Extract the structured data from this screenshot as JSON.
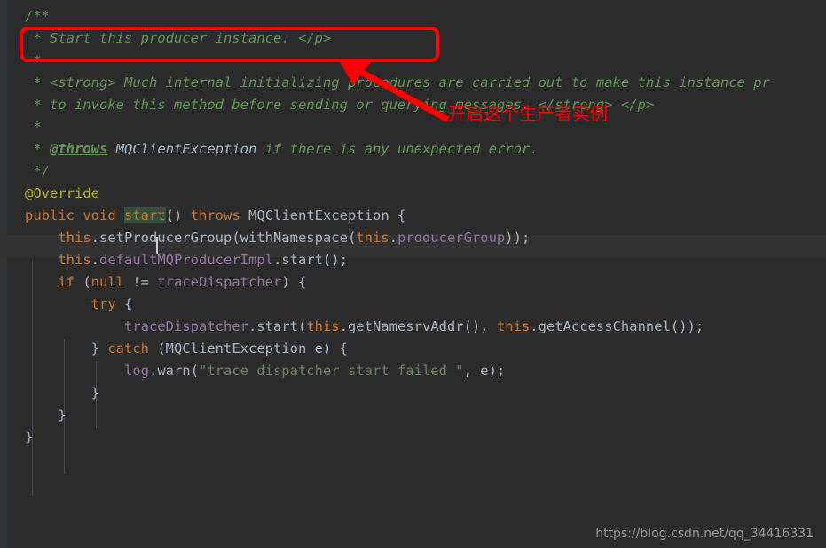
{
  "editor": {
    "background_color": "#2b2b2b",
    "current_line_color": "#323232",
    "gutter_color": "#313335",
    "language": "java",
    "caret_line": 11,
    "caret_column": 4,
    "identifier_under_caret": "start"
  },
  "colors": {
    "comment": "#629755",
    "keyword": "#cc7832",
    "annotation": "#bbb529",
    "field": "#9876aa",
    "string": "#6a8759",
    "plain": "#a9b7c6",
    "annotation_red": "#fe0000",
    "occurrence_highlight": "#32503c"
  },
  "code": {
    "lines": [
      {
        "indent": 0,
        "tokens": [
          {
            "t": "/**",
            "c": "comment"
          }
        ]
      },
      {
        "indent": 0,
        "tokens": [
          {
            "t": " * Start this producer instance. </p>",
            "c": "comment"
          }
        ]
      },
      {
        "indent": 0,
        "tokens": [
          {
            "t": " *",
            "c": "comment"
          }
        ]
      },
      {
        "indent": 0,
        "tokens": [
          {
            "t": " * <strong> Much internal initializing procedures are carried out to make this instance pr",
            "c": "comment"
          }
        ]
      },
      {
        "indent": 0,
        "tokens": [
          {
            "t": " * to invoke this method before sending or querying messages. </strong> </p>",
            "c": "comment"
          }
        ]
      },
      {
        "indent": 0,
        "tokens": [
          {
            "t": " *",
            "c": "comment"
          }
        ]
      },
      {
        "indent": 0,
        "tokens": [
          {
            "t": " * ",
            "c": "comment"
          },
          {
            "t": "@throws",
            "c": "doctag"
          },
          {
            "t": " ",
            "c": "comment"
          },
          {
            "t": "MQClientException",
            "c": "docclass"
          },
          {
            "t": " if there is any unexpected error.",
            "c": "comment"
          }
        ]
      },
      {
        "indent": 0,
        "tokens": [
          {
            "t": " */",
            "c": "comment"
          }
        ]
      },
      {
        "indent": 0,
        "tokens": [
          {
            "t": "@Override",
            "c": "anno"
          }
        ]
      },
      {
        "indent": 0,
        "tokens": [
          {
            "t": "public",
            "c": "keyword"
          },
          {
            "t": " ",
            "c": "plain"
          },
          {
            "t": "void",
            "c": "keyword"
          },
          {
            "t": " ",
            "c": "plain"
          },
          {
            "t": "start",
            "c": "keyword",
            "hl": true
          },
          {
            "t": "() ",
            "c": "plain"
          },
          {
            "t": "throws",
            "c": "keyword"
          },
          {
            "t": " ",
            "c": "plain"
          },
          {
            "t": "MQClientException",
            "c": "class"
          },
          {
            "t": " {",
            "c": "plain"
          }
        ]
      },
      {
        "indent": 1,
        "tokens": [
          {
            "t": "this",
            "c": "keyword"
          },
          {
            "t": ".setProducerGroup(withNamespace(",
            "c": "plain"
          },
          {
            "t": "this",
            "c": "keyword"
          },
          {
            "t": ".",
            "c": "plain"
          },
          {
            "t": "producerGroup",
            "c": "field"
          },
          {
            "t": "));",
            "c": "plain"
          }
        ]
      },
      {
        "indent": 1,
        "tokens": [
          {
            "t": "this",
            "c": "keyword"
          },
          {
            "t": ".",
            "c": "plain"
          },
          {
            "t": "defaultMQProducerImpl",
            "c": "field"
          },
          {
            "t": ".start();",
            "c": "plain"
          }
        ]
      },
      {
        "indent": 1,
        "tokens": [
          {
            "t": "if",
            "c": "keyword"
          },
          {
            "t": " (",
            "c": "plain"
          },
          {
            "t": "null",
            "c": "keyword"
          },
          {
            "t": " != ",
            "c": "plain"
          },
          {
            "t": "traceDispatcher",
            "c": "field"
          },
          {
            "t": ") {",
            "c": "plain"
          }
        ]
      },
      {
        "indent": 2,
        "tokens": [
          {
            "t": "try",
            "c": "keyword"
          },
          {
            "t": " {",
            "c": "plain"
          }
        ]
      },
      {
        "indent": 3,
        "tokens": [
          {
            "t": "traceDispatcher",
            "c": "field"
          },
          {
            "t": ".start(",
            "c": "plain"
          },
          {
            "t": "this",
            "c": "keyword"
          },
          {
            "t": ".getNamesrvAddr(), ",
            "c": "plain"
          },
          {
            "t": "this",
            "c": "keyword"
          },
          {
            "t": ".getAccessChannel());",
            "c": "plain"
          }
        ]
      },
      {
        "indent": 2,
        "tokens": [
          {
            "t": "} ",
            "c": "plain"
          },
          {
            "t": "catch",
            "c": "keyword"
          },
          {
            "t": " (MQClientException e) {",
            "c": "plain"
          }
        ]
      },
      {
        "indent": 3,
        "tokens": [
          {
            "t": "log",
            "c": "field"
          },
          {
            "t": ".warn(",
            "c": "plain"
          },
          {
            "t": "\"trace dispatcher start failed \"",
            "c": "string"
          },
          {
            "t": ", e);",
            "c": "plain"
          }
        ]
      },
      {
        "indent": 2,
        "tokens": [
          {
            "t": "}",
            "c": "plain"
          }
        ]
      },
      {
        "indent": 1,
        "tokens": [
          {
            "t": "}",
            "c": "plain"
          }
        ]
      },
      {
        "indent": 0,
        "tokens": [
          {
            "t": "}",
            "c": "plain"
          }
        ]
      }
    ]
  },
  "annotation": {
    "box_label": "highlight-box-around-javadoc-summary",
    "arrow_label": "pointer-arrow",
    "text": "开启这个生产者实例"
  },
  "watermark": {
    "text": "https://blog.csdn.net/qq_34416331"
  }
}
